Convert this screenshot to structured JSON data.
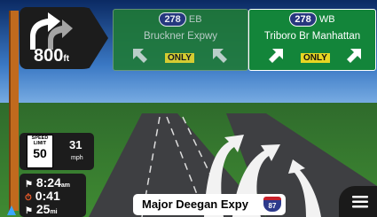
{
  "maneuver": {
    "distance_value": "800",
    "distance_unit": "ft"
  },
  "signs": [
    {
      "route": "278",
      "direction": "EB",
      "name": "Bruckner Expwy",
      "only_label": "ONLY"
    },
    {
      "route": "278",
      "direction": "WB",
      "name": "Triboro Br  Manhattan",
      "only_label": "ONLY"
    }
  ],
  "speed": {
    "limit_line1": "SPEED",
    "limit_line2": "LIMIT",
    "limit_value": "50",
    "current": "31",
    "unit": "mph"
  },
  "trip": {
    "arrival_time": "8:24",
    "arrival_suffix": "am",
    "time_remaining": "0:41",
    "distance_remaining": "25",
    "distance_unit": "mi"
  },
  "street": {
    "name": "Major Deegan Expy",
    "shield_number": "87"
  },
  "colors": {
    "sign_green": "#13853a",
    "only_yellow": "#e7d623",
    "interstate_blue": "#2d3a8c"
  }
}
